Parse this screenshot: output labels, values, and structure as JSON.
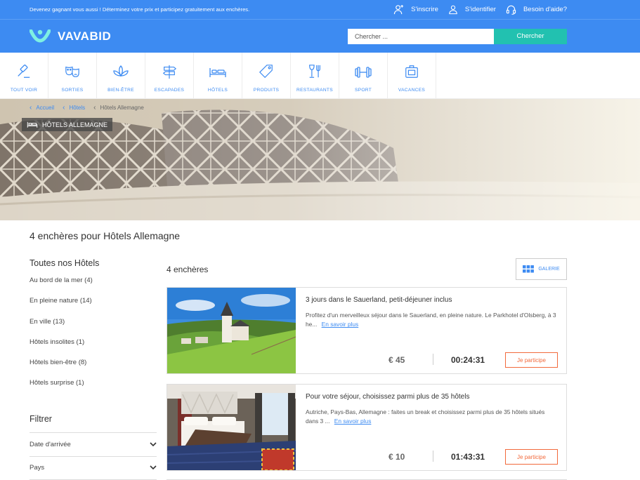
{
  "topbar": {
    "promo": "Devenez gagnant vous aussi ! Déterminez votre prix et participez gratuitement aux enchères.",
    "register": "S'inscrire",
    "login": "S'identifier",
    "help": "Besoin d'aide?"
  },
  "header": {
    "logo": "VAVABID",
    "search_placeholder": "Chercher ...",
    "search_button": "Chercher"
  },
  "categories": [
    {
      "label": "TOUT VOIR",
      "icon": "gavel-icon"
    },
    {
      "label": "SORTIES",
      "icon": "theater-masks-icon"
    },
    {
      "label": "BIEN-ÊTRE",
      "icon": "lotus-icon"
    },
    {
      "label": "ESCAPADES",
      "icon": "signpost-icon"
    },
    {
      "label": "HÔTELS",
      "icon": "bed-icon"
    },
    {
      "label": "PRODUITS",
      "icon": "tag-icon"
    },
    {
      "label": "RESTAURANTS",
      "icon": "wine-fork-icon"
    },
    {
      "label": "SPORT",
      "icon": "dumbbell-icon"
    },
    {
      "label": "VACANCES",
      "icon": "suitcase-icon"
    }
  ],
  "breadcrumb": [
    "Accueil",
    "Hôtels",
    "Hôtels Allemagne"
  ],
  "hero_label": "HÔTELS ALLEMAGNE",
  "page_title": "4 enchères pour Hôtels Allemagne",
  "sidebar": {
    "title": "Toutes nos Hôtels",
    "items": [
      "Au bord de la mer (4)",
      "En pleine nature (14)",
      "En ville (13)",
      "Hôtels insolites (1)",
      "Hôtels bien-être (8)",
      "Hôtels surprise (1)"
    ],
    "filter_title": "Filtrer",
    "filters": [
      "Date d'arrivée",
      "Pays"
    ]
  },
  "results": {
    "count": "4 enchères",
    "gallery_label": "GALERIE",
    "cards": [
      {
        "title": "3 jours dans le Sauerland, petit-déjeuner inclus",
        "desc": "Profitez d'un merveilleux séjour dans le Sauerland, en pleine nature. Le Parkhotel d'Olsberg, à 3 he...",
        "more": "En savoir plus",
        "price": "€ 45",
        "timer": "00:24:31",
        "button": "Je participe"
      },
      {
        "title": "Pour votre séjour, choisissez parmi plus de 35 hôtels",
        "desc": "Autriche, Pays-Bas, Allemagne : faites un break et choisissez parmi plus de 35 hôtels situés dans 3 ...",
        "more": "En savoir plus",
        "price": "€ 10",
        "timer": "01:43:31",
        "button": "Je participe"
      }
    ]
  },
  "colors": {
    "brand_blue": "#3d8bf2",
    "search_teal": "#22c1b0",
    "cta_orange": "#f26a3c"
  }
}
